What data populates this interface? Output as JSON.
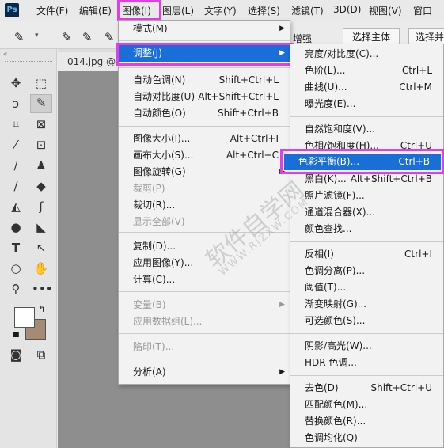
{
  "menubar": {
    "logo": "Ps",
    "items": [
      "文件(F)",
      "编辑(E)",
      "图像(I)",
      "图层(L)",
      "文字(Y)",
      "选择(S)",
      "滤镜(T)",
      "3D(D)",
      "视图(V)",
      "窗口"
    ]
  },
  "options": {
    "btn1": "增强",
    "btn2": "选择主体",
    "btn3": "选择并"
  },
  "document": {
    "tab": "014.jpg @"
  },
  "image_menu": {
    "items": [
      {
        "label": "模式(M)",
        "submenu": true
      },
      {
        "label": "调整(J)",
        "submenu": true,
        "highlighted": true
      },
      {
        "label": "自动色调(N)",
        "shortcut": "Shift+Ctrl+L"
      },
      {
        "label": "自动对比度(U)",
        "shortcut": "Alt+Shift+Ctrl+L"
      },
      {
        "label": "自动颜色(O)",
        "shortcut": "Shift+Ctrl+B"
      },
      {
        "label": "图像大小(I)...",
        "shortcut": "Alt+Ctrl+I"
      },
      {
        "label": "画布大小(S)...",
        "shortcut": "Alt+Ctrl+C"
      },
      {
        "label": "图像旋转(G)",
        "submenu": true
      },
      {
        "label": "裁剪(P)",
        "disabled": true
      },
      {
        "label": "裁切(R)..."
      },
      {
        "label": "显示全部(V)",
        "disabled": true
      },
      {
        "label": "复制(D)..."
      },
      {
        "label": "应用图像(Y)..."
      },
      {
        "label": "计算(C)..."
      },
      {
        "label": "变量(B)",
        "submenu": true,
        "disabled": true
      },
      {
        "label": "应用数据组(L)...",
        "disabled": true
      },
      {
        "label": "陷印(T)...",
        "disabled": true
      },
      {
        "label": "分析(A)",
        "submenu": true
      }
    ]
  },
  "adjust_menu": {
    "items": [
      {
        "label": "亮度/对比度(C)..."
      },
      {
        "label": "色阶(L)...",
        "shortcut": "Ctrl+L"
      },
      {
        "label": "曲线(U)...",
        "shortcut": "Ctrl+M"
      },
      {
        "label": "曝光度(E)..."
      },
      {
        "label": "自然饱和度(V)..."
      },
      {
        "label": "色相/饱和度(H)...",
        "shortcut": "Ctrl+U"
      },
      {
        "label": "色彩平衡(B)...",
        "shortcut": "Ctrl+B",
        "highlighted": true
      },
      {
        "label": "黑白(K)...",
        "shortcut": "Alt+Shift+Ctrl+B"
      },
      {
        "label": "照片滤镜(F)..."
      },
      {
        "label": "通道混合器(X)..."
      },
      {
        "label": "颜色查找..."
      },
      {
        "label": "反相(I)",
        "shortcut": "Ctrl+I"
      },
      {
        "label": "色调分离(P)..."
      },
      {
        "label": "阈值(T)..."
      },
      {
        "label": "渐变映射(G)..."
      },
      {
        "label": "可选颜色(S)..."
      },
      {
        "label": "阴影/高光(W)..."
      },
      {
        "label": "HDR 色调..."
      },
      {
        "label": "去色(D)",
        "shortcut": "Shift+Ctrl+U"
      },
      {
        "label": "匹配颜色(M)..."
      },
      {
        "label": "替换颜色(R)..."
      },
      {
        "label": "色调均化(Q)"
      }
    ]
  },
  "watermark": "软件自学网",
  "watermark_url": "WWW.RJZXW.COM",
  "colors": {
    "highlight": "#1a6ed8",
    "annotation": "#e43ce8",
    "background_swatch": "#a58b76"
  }
}
